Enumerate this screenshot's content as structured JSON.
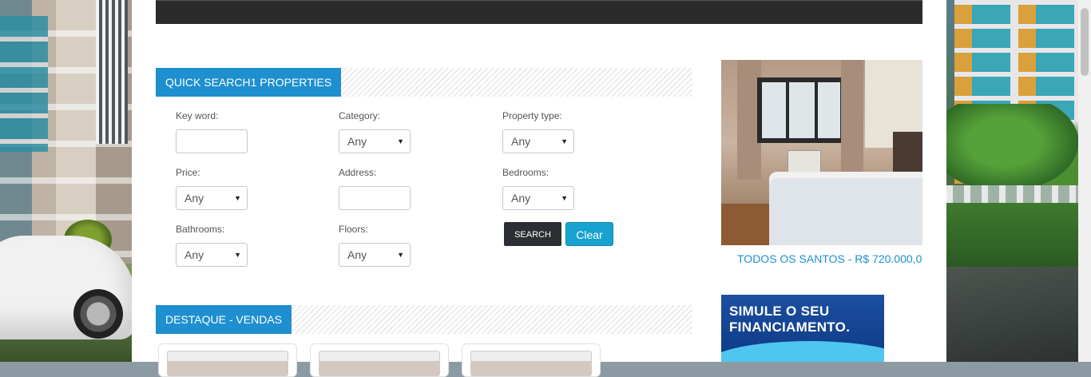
{
  "quick_search": {
    "title": "QUICK SEARCH1 PROPERTIES",
    "fields": {
      "keyword_label": "Key word:",
      "category_label": "Category:",
      "property_type_label": "Property type:",
      "price_label": "Price:",
      "address_label": "Address:",
      "bedrooms_label": "Bedrooms:",
      "bathrooms_label": "Bathrooms:",
      "floors_label": "Floors:"
    },
    "selects": {
      "category_value": "Any",
      "property_type_value": "Any",
      "price_value": "Any",
      "bedrooms_value": "Any",
      "bathrooms_value": "Any",
      "floors_value": "Any"
    },
    "search_label": "SEARCH",
    "clear_label": "Clear"
  },
  "featured": {
    "title": "DESTAQUE - VENDAS"
  },
  "sidebar": {
    "property_caption": "TODOS OS SANTOS - R$ 720.000,0",
    "banner_line1": "SIMULE O SEU",
    "banner_line2": "FINANCIAMENTO."
  }
}
